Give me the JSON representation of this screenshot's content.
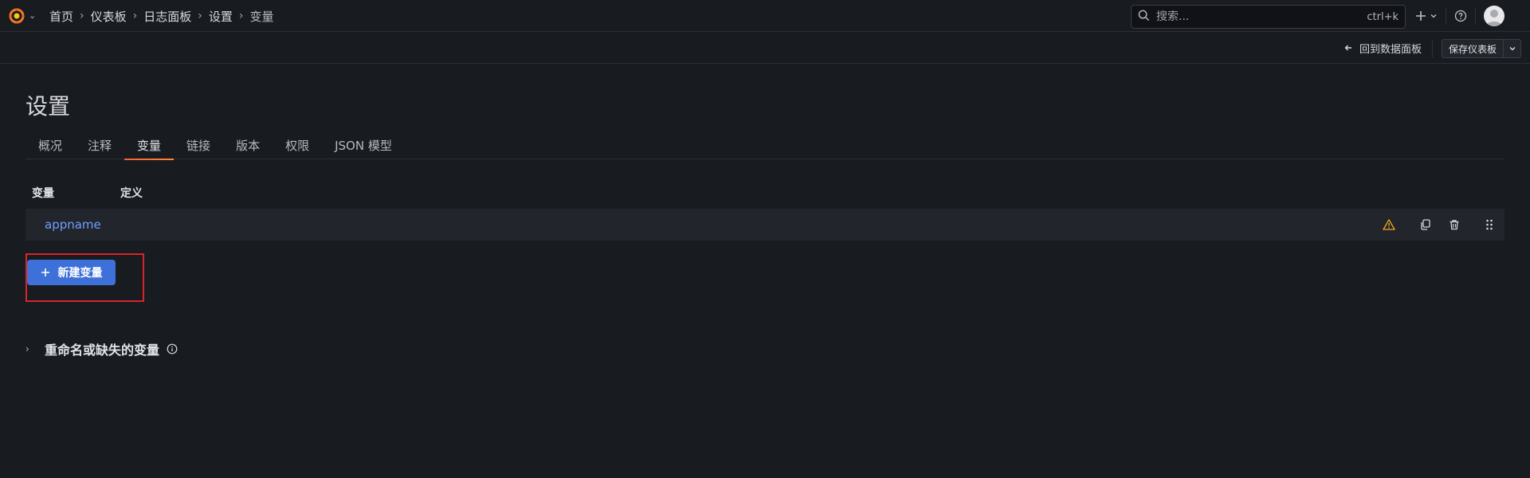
{
  "topbar": {
    "breadcrumbs": [
      "首页",
      "仪表板",
      "日志面板",
      "设置",
      "变量"
    ],
    "search": {
      "placeholder": "搜索...",
      "shortcut": "ctrl+k"
    }
  },
  "subbar": {
    "back_label": "回到数据面板",
    "save_label": "保存仪表板"
  },
  "page": {
    "title": "设置",
    "tabs": [
      "概况",
      "注释",
      "变量",
      "链接",
      "版本",
      "权限",
      "JSON 模型"
    ],
    "active_tab": "变量"
  },
  "table": {
    "headers": {
      "variable": "变量",
      "definition": "定义"
    },
    "rows": [
      {
        "name": "appname",
        "definition": "",
        "status_icon": "warning-icon"
      }
    ]
  },
  "new_variable_label": "新建变量",
  "missing_section_label": "重命名或缺失的变量",
  "colors": {
    "background": "#181b1f",
    "accent_blue": "#3d71d9",
    "link_blue": "#6e9fff",
    "warning": "#f5a623",
    "highlight": "#d7252b",
    "tab_underline": "#ff8833"
  }
}
